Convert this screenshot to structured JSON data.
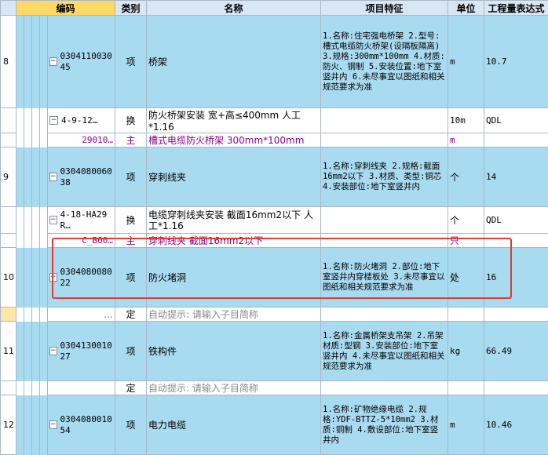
{
  "headers": {
    "code": "编码",
    "type": "类别",
    "name": "名称",
    "feature": "项目特征",
    "unit": "单位",
    "expr": "工程量表达式"
  },
  "rows": {
    "r8": {
      "num": "8",
      "code": "0304110030 45",
      "type": "项",
      "name": "桥架",
      "unit": "m",
      "expr": "10.7",
      "feature": "1.名称:住宅强电桥架 2.型号:槽式电缆防火桥架(设隔板隔离) 3.规格:300mm*100mm 4.材质:防火、钢制 5.安装位置:地下室竖井内 6.未尽事宜以图纸和相关规范要求为准"
    },
    "r8a": {
      "code": "4-9-12…",
      "type": "换",
      "name": "防火桥架安装 宽+高≤400mm 人工*1.16",
      "unit": "10m",
      "expr": "QDL"
    },
    "r8b": {
      "code": "29010…",
      "type": "主",
      "name": "槽式电缆防火桥架 300mm*100mm",
      "unit": "m",
      "expr": ""
    },
    "r9": {
      "num": "9",
      "code": "0304080060 38",
      "type": "项",
      "name": "穿刺线夹",
      "unit": "个",
      "expr": "14",
      "feature": "1.名称:穿刺线夹 2.规格:截面16mm2以下 3.材质、类型:铜芯 4.安装部位:地下室竖井内"
    },
    "r9a": {
      "code": "4-18-HA29 R…",
      "type": "换",
      "name": "电缆穿刺线夹安装 截面16mm2以下 人工*1.16",
      "unit": "个",
      "expr": "QDL"
    },
    "r9b": {
      "code": "C_B00…",
      "type": "主",
      "name": "穿刺线夹 截面16mm2以下",
      "unit": "只",
      "expr": ""
    },
    "r10": {
      "num": "10",
      "code": "0304080080 22",
      "type": "项",
      "name": "防火堵洞",
      "unit": "处",
      "expr": "16",
      "feature": "1.名称:防火堵洞 2.部位:地下室竖井内穿楼板处 3.未尽事宜以图纸和相关规范要求为准"
    },
    "r10a": {
      "code": "…",
      "type": "定",
      "name": "自动提示: 请输入子目简称"
    },
    "r11": {
      "num": "11",
      "code": "0304130010 27",
      "type": "项",
      "name": "铁构件",
      "unit": "kg",
      "expr": "66.49",
      "feature": "1.名称:金属桥架支吊架 2.吊架材质:型钢 3.安装部位:地下室竖井内 4.未尽事宜以图纸和相关规范要求为准"
    },
    "r11a": {
      "code": "",
      "type": "定",
      "name": "自动提示: 请输入子目简称"
    },
    "r12": {
      "num": "12",
      "code": "0304080010 54",
      "type": "项",
      "name": "电力电缆",
      "unit": "m",
      "expr": "10.46",
      "feature": "1.名称:矿物绝缘电缆 2.规格:YDF-BTTZ-5*10mm2 3.材质:铜制 4.敷设部位:地下室竖井内"
    }
  }
}
